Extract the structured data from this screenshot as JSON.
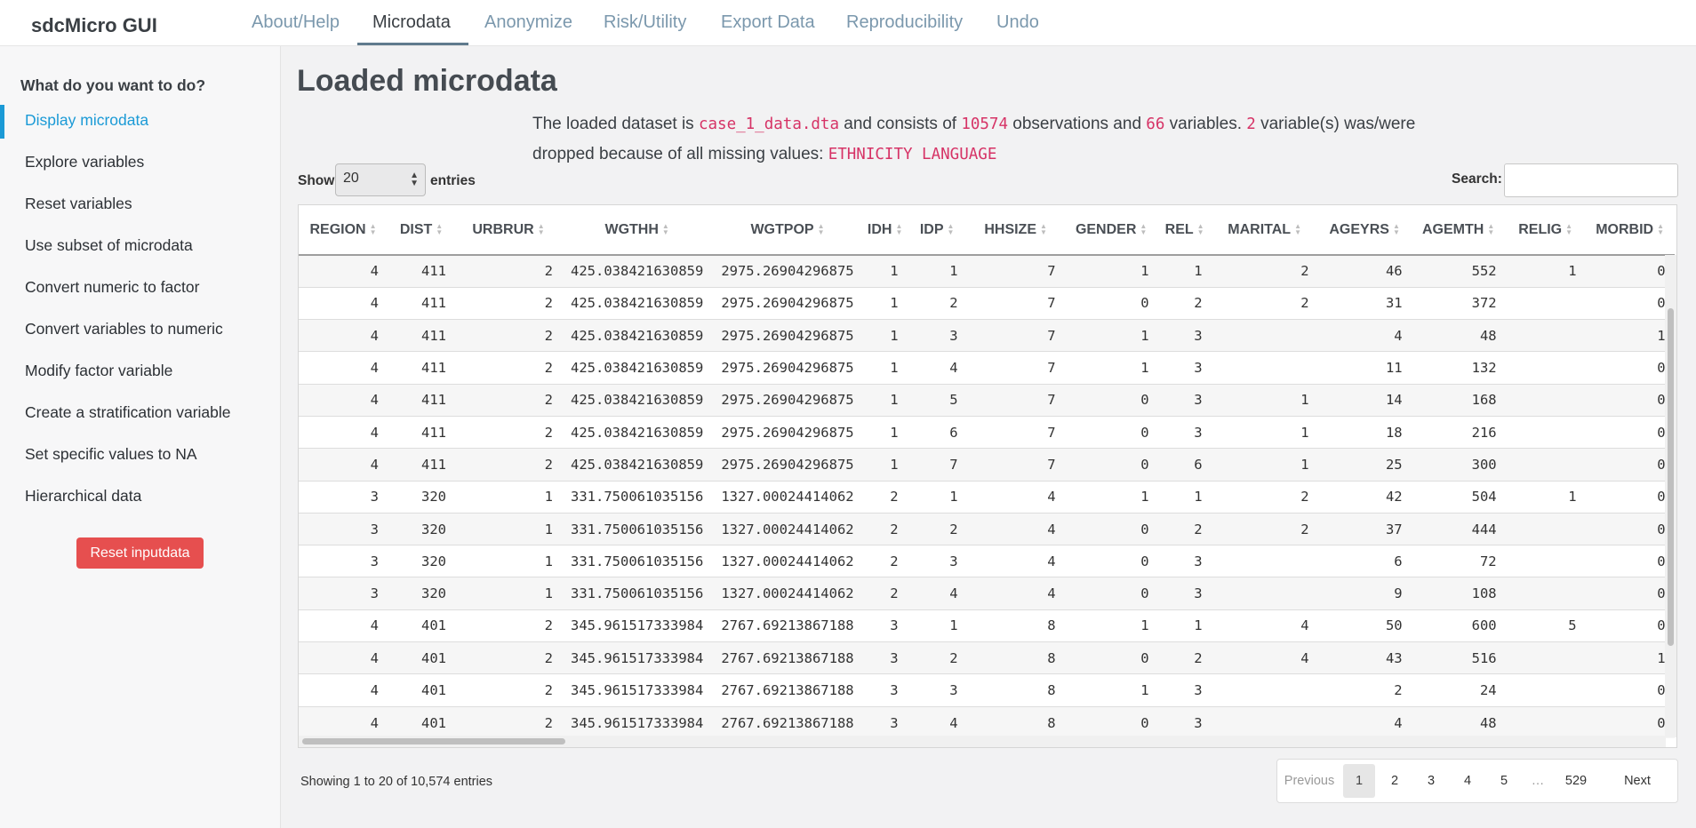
{
  "navbar": {
    "brand": "sdcMicro GUI",
    "tabs": [
      {
        "label": "About/Help"
      },
      {
        "label": "Microdata"
      },
      {
        "label": "Anonymize"
      },
      {
        "label": "Risk/Utility"
      },
      {
        "label": "Export Data"
      },
      {
        "label": "Reproducibility"
      },
      {
        "label": "Undo"
      }
    ],
    "active_tab": "Microdata"
  },
  "sidebar": {
    "heading": "What do you want to do?",
    "items": [
      {
        "label": "Display microdata"
      },
      {
        "label": "Explore variables"
      },
      {
        "label": "Reset variables"
      },
      {
        "label": "Use subset of microdata"
      },
      {
        "label": "Convert numeric to factor"
      },
      {
        "label": "Convert variables to numeric"
      },
      {
        "label": "Modify factor variable"
      },
      {
        "label": "Create a stratification variable"
      },
      {
        "label": "Set specific values to NA"
      },
      {
        "label": "Hierarchical data"
      }
    ],
    "active_item": "Display microdata",
    "reset_button": "Reset inputdata"
  },
  "main": {
    "title": "Loaded microdata",
    "info": {
      "t1": "The loaded dataset is",
      "file": "case_1_data.dta",
      "t2": "and consists of",
      "obs": "10574",
      "t3": "observations and",
      "vars": "66",
      "t4": "variables.",
      "dropped": "2",
      "t5": "variable(s) was/were dropped because of all missing values:",
      "dropped_vars": "ETHNICITY LANGUAGE"
    },
    "show_label": "Show",
    "page_size": "20",
    "entries_label": "entries",
    "search_label": "Search:",
    "search_value": "",
    "columns": [
      "REGION",
      "DIST",
      "URBRUR",
      "WGTHH",
      "WGTPOP",
      "IDH",
      "IDP",
      "HHSIZE",
      "GENDER",
      "REL",
      "MARITAL",
      "AGEYRS",
      "AGEMTH",
      "RELIG",
      "MORBID"
    ],
    "rows": [
      [
        "4",
        "411",
        "2",
        "425.038421630859",
        "2975.26904296875",
        "1",
        "1",
        "7",
        "1",
        "1",
        "2",
        "46",
        "552",
        "1",
        "0"
      ],
      [
        "4",
        "411",
        "2",
        "425.038421630859",
        "2975.26904296875",
        "1",
        "2",
        "7",
        "0",
        "2",
        "2",
        "31",
        "372",
        "",
        "0"
      ],
      [
        "4",
        "411",
        "2",
        "425.038421630859",
        "2975.26904296875",
        "1",
        "3",
        "7",
        "1",
        "3",
        "",
        "4",
        "48",
        "",
        "1"
      ],
      [
        "4",
        "411",
        "2",
        "425.038421630859",
        "2975.26904296875",
        "1",
        "4",
        "7",
        "1",
        "3",
        "",
        "11",
        "132",
        "",
        "0"
      ],
      [
        "4",
        "411",
        "2",
        "425.038421630859",
        "2975.26904296875",
        "1",
        "5",
        "7",
        "0",
        "3",
        "1",
        "14",
        "168",
        "",
        "0"
      ],
      [
        "4",
        "411",
        "2",
        "425.038421630859",
        "2975.26904296875",
        "1",
        "6",
        "7",
        "0",
        "3",
        "1",
        "18",
        "216",
        "",
        "0"
      ],
      [
        "4",
        "411",
        "2",
        "425.038421630859",
        "2975.26904296875",
        "1",
        "7",
        "7",
        "0",
        "6",
        "1",
        "25",
        "300",
        "",
        "0"
      ],
      [
        "3",
        "320",
        "1",
        "331.750061035156",
        "1327.00024414062",
        "2",
        "1",
        "4",
        "1",
        "1",
        "2",
        "42",
        "504",
        "1",
        "0"
      ],
      [
        "3",
        "320",
        "1",
        "331.750061035156",
        "1327.00024414062",
        "2",
        "2",
        "4",
        "0",
        "2",
        "2",
        "37",
        "444",
        "",
        "0"
      ],
      [
        "3",
        "320",
        "1",
        "331.750061035156",
        "1327.00024414062",
        "2",
        "3",
        "4",
        "0",
        "3",
        "",
        "6",
        "72",
        "",
        "0"
      ],
      [
        "3",
        "320",
        "1",
        "331.750061035156",
        "1327.00024414062",
        "2",
        "4",
        "4",
        "0",
        "3",
        "",
        "9",
        "108",
        "",
        "0"
      ],
      [
        "4",
        "401",
        "2",
        "345.961517333984",
        "2767.69213867188",
        "3",
        "1",
        "8",
        "1",
        "1",
        "4",
        "50",
        "600",
        "5",
        "0"
      ],
      [
        "4",
        "401",
        "2",
        "345.961517333984",
        "2767.69213867188",
        "3",
        "2",
        "8",
        "0",
        "2",
        "4",
        "43",
        "516",
        "",
        "1"
      ],
      [
        "4",
        "401",
        "2",
        "345.961517333984",
        "2767.69213867188",
        "3",
        "3",
        "8",
        "1",
        "3",
        "",
        "2",
        "24",
        "",
        "0"
      ],
      [
        "4",
        "401",
        "2",
        "345.961517333984",
        "2767.69213867188",
        "3",
        "4",
        "8",
        "0",
        "3",
        "",
        "4",
        "48",
        "",
        "0"
      ]
    ],
    "showing_text": "Showing 1 to 20 of 10,574 entries",
    "pagination": {
      "previous": "Previous",
      "pages": [
        "1",
        "2",
        "3",
        "4",
        "5",
        "…",
        "529"
      ],
      "current": "1",
      "next": "Next"
    }
  }
}
